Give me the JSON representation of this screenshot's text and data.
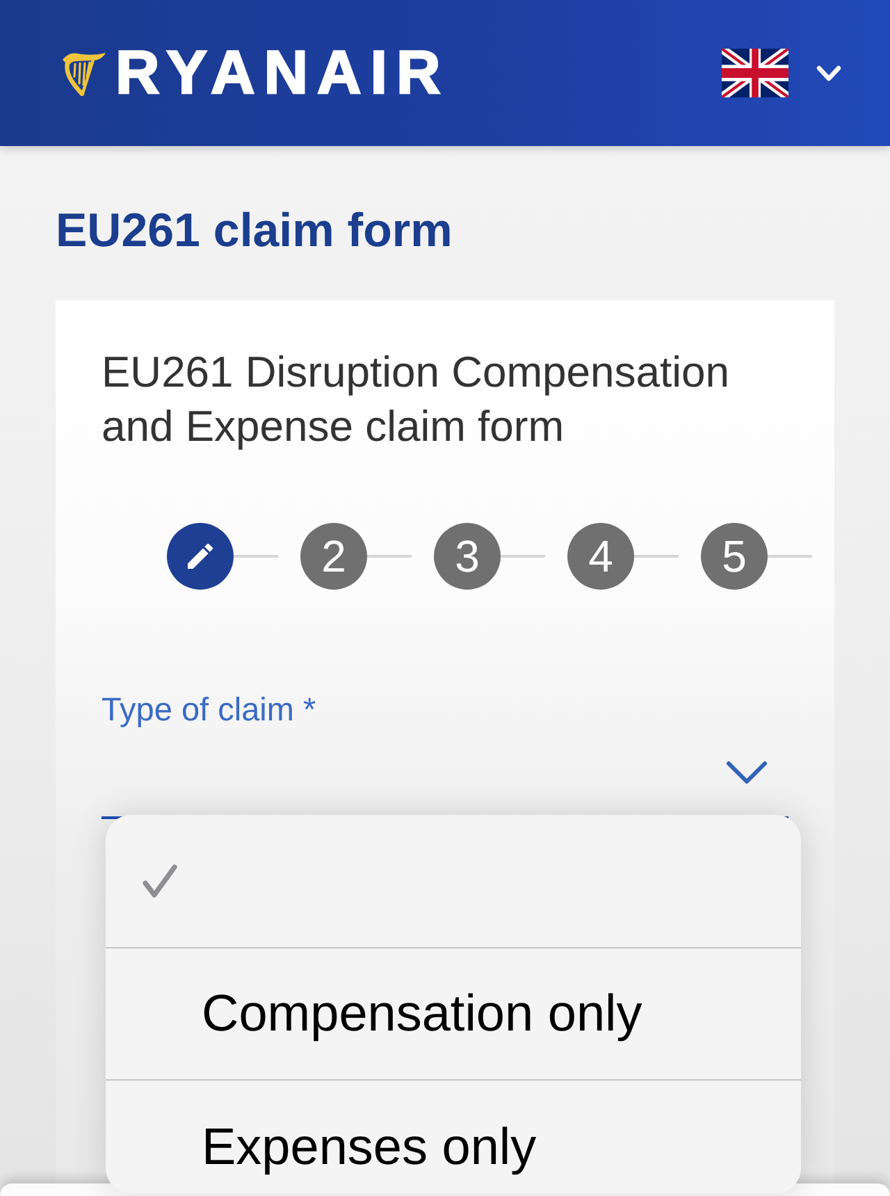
{
  "header": {
    "logo": "RYANAIR"
  },
  "page_title": "EU261 claim form",
  "form": {
    "heading": "EU261 Disruption Compensation and Expense claim form",
    "steps": [
      {
        "kind": "edit",
        "selected": true
      },
      {
        "kind": "number",
        "label": "2",
        "selected": false
      },
      {
        "kind": "number",
        "label": "3",
        "selected": false
      },
      {
        "kind": "number",
        "label": "4",
        "selected": false
      },
      {
        "kind": "number",
        "label": "5",
        "selected": false
      }
    ],
    "fields": [
      {
        "label": "Type of claim *",
        "focused": true
      }
    ]
  },
  "picker": {
    "options": [
      {
        "selected": true
      },
      {
        "label": "Compensation only",
        "selected": false
      },
      {
        "label": "Expenses only",
        "selected": false
      }
    ]
  }
}
